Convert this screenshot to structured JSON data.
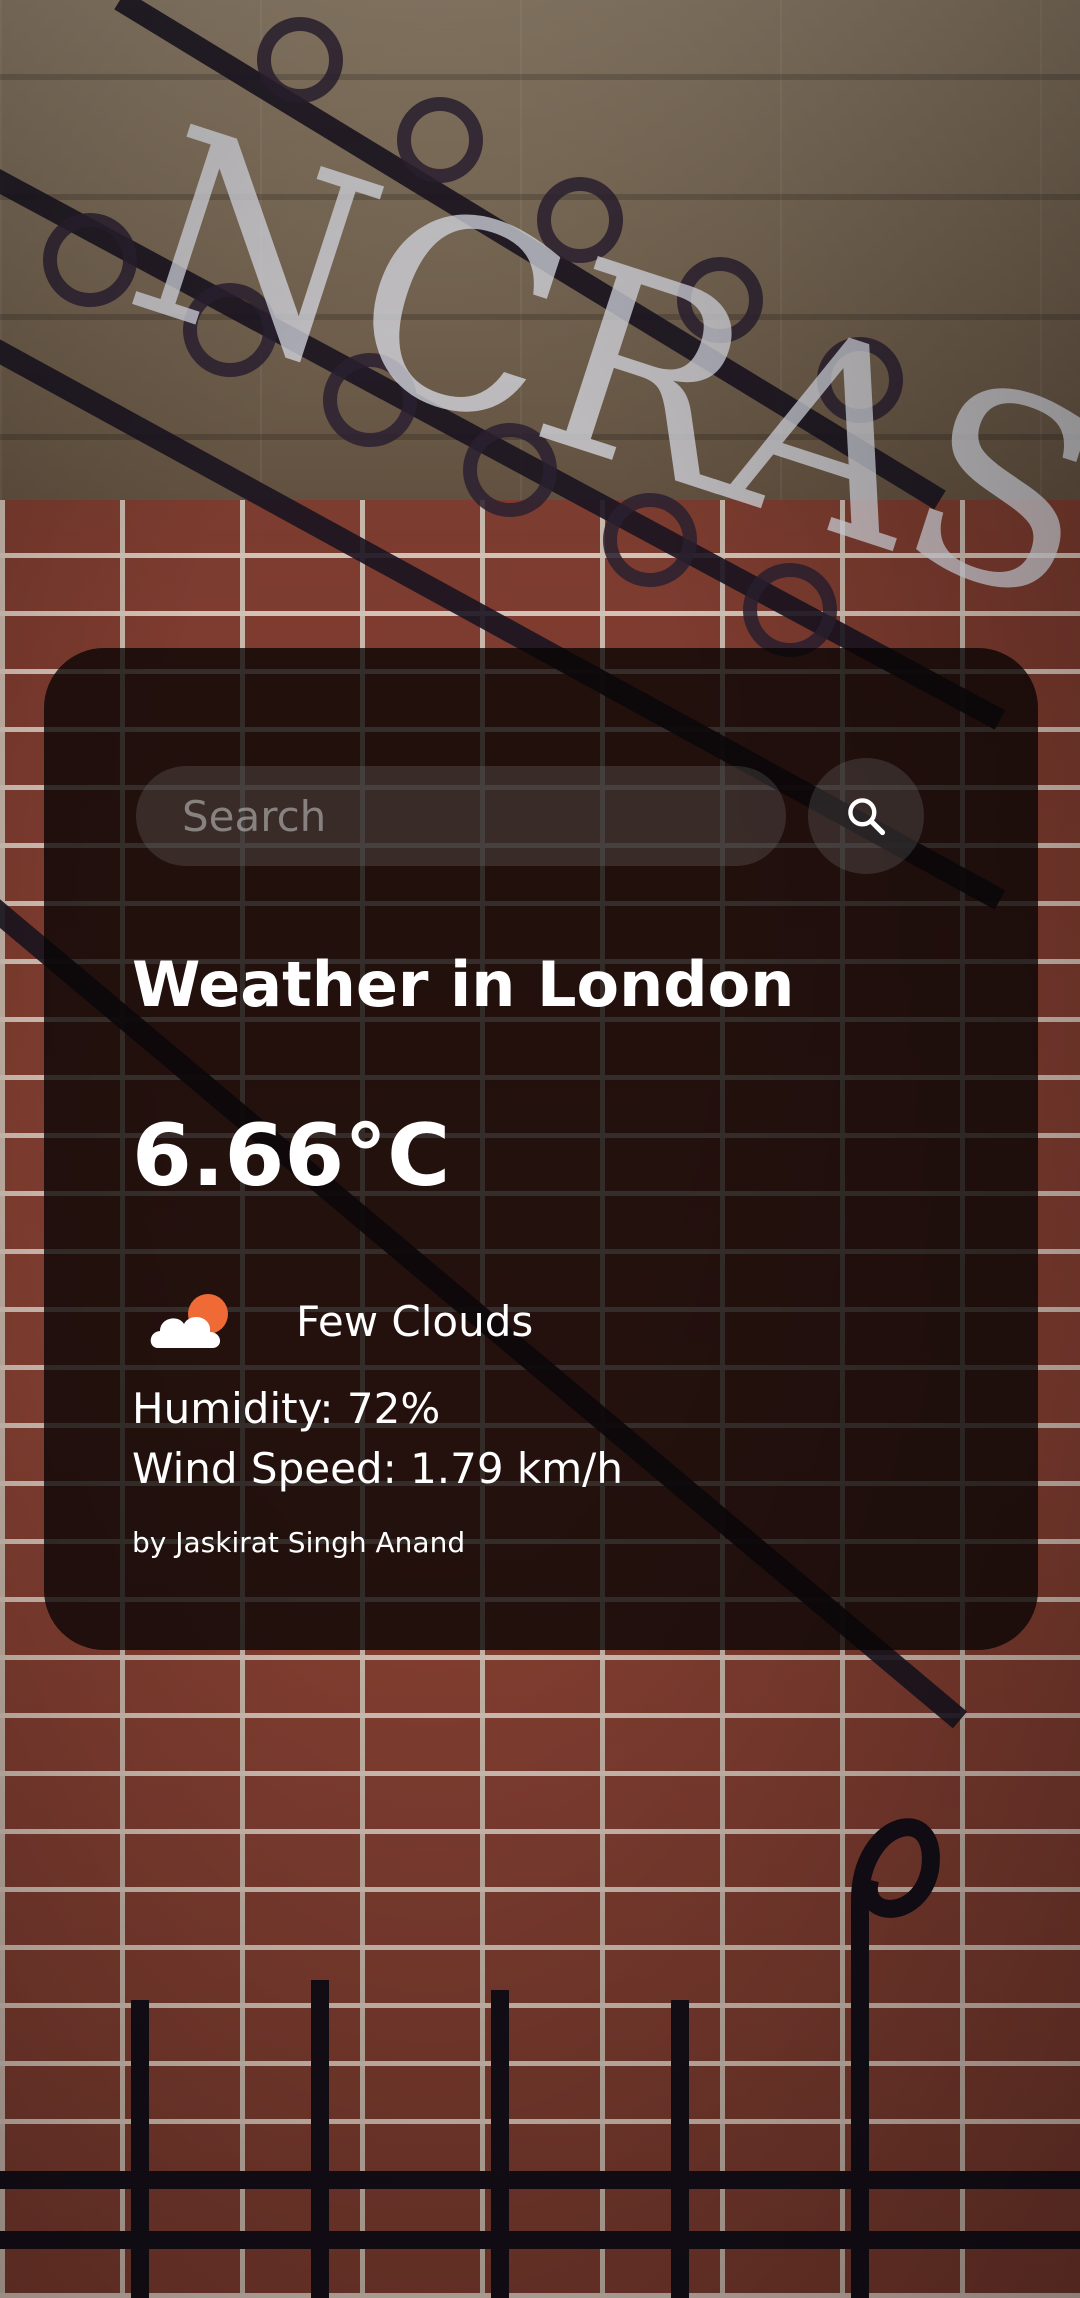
{
  "search": {
    "placeholder": "Search",
    "value": ""
  },
  "weather": {
    "title": "Weather in London",
    "temperature": "6.66°C",
    "condition": "Few Clouds",
    "condition_icon": "few-clouds-day-icon",
    "humidity": "Humidity: 72%",
    "wind_speed": "Wind Speed: 1.79 km/h"
  },
  "footer": {
    "credit": "by Jaskirat Singh Anand"
  },
  "icons": {
    "search": "search-icon"
  },
  "colors": {
    "card_background": "#080404",
    "text": "#ffffff",
    "sun": "#f06a35",
    "cloud": "#ffffff"
  }
}
